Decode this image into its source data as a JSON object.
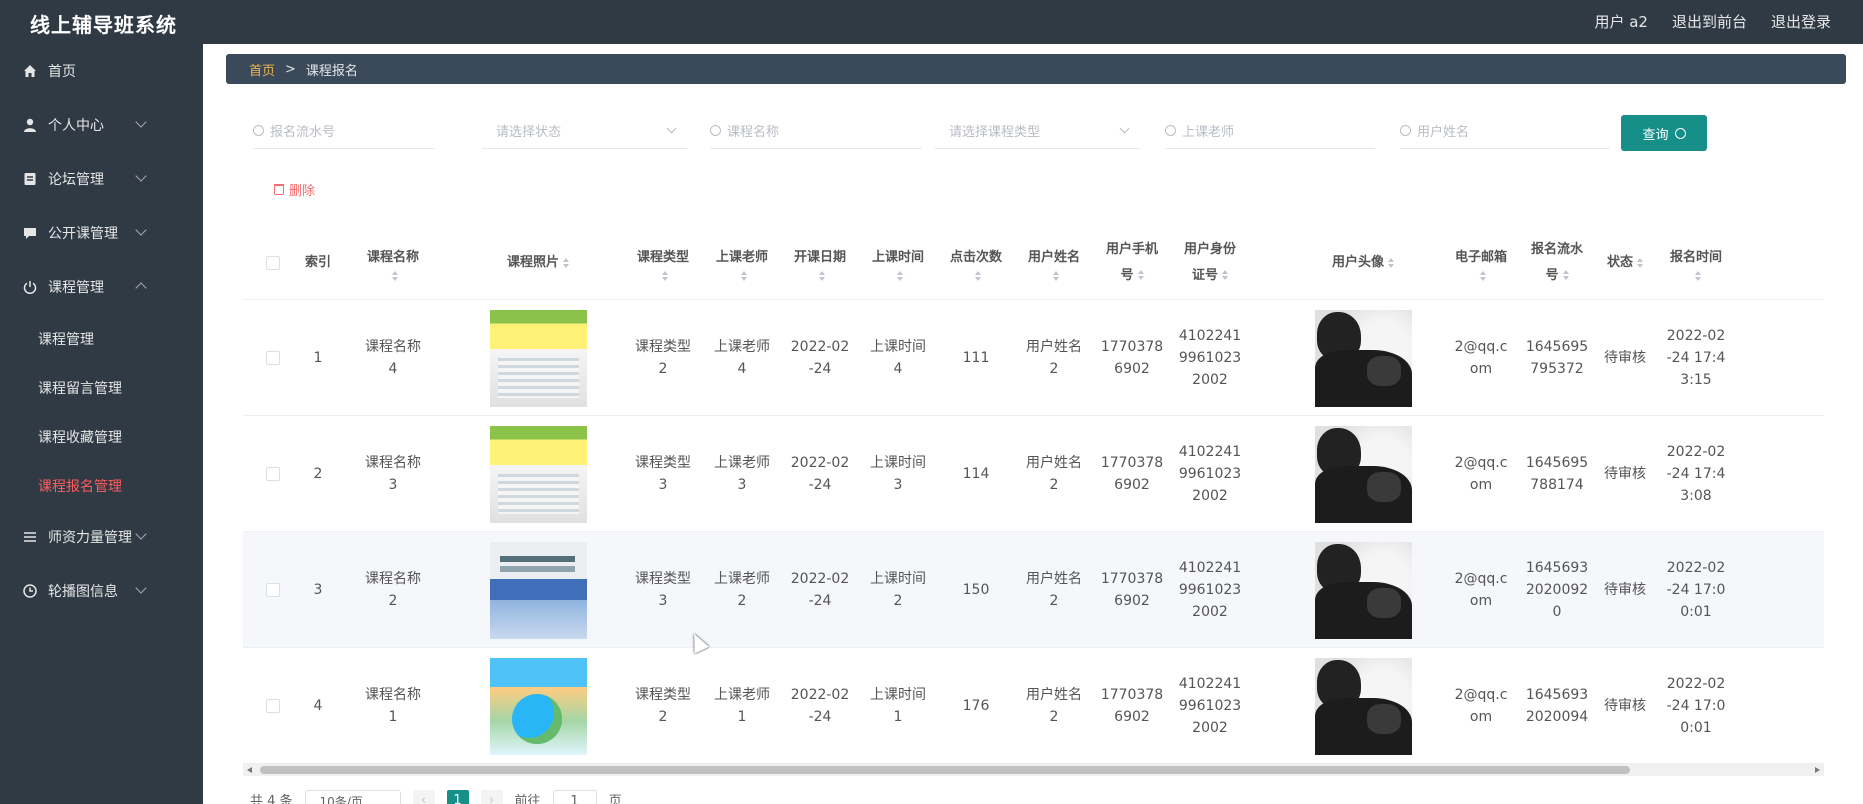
{
  "app": {
    "title": "线上辅导班系统",
    "top_links": [
      "用户 a2",
      "退出到前台",
      "退出登录"
    ]
  },
  "sidebar": {
    "items": [
      {
        "label": "首页",
        "icon": "home-icon",
        "expandable": false
      },
      {
        "label": "个人中心",
        "icon": "user-icon",
        "expandable": true
      },
      {
        "label": "论坛管理",
        "icon": "forum-icon",
        "expandable": true
      },
      {
        "label": "公开课管理",
        "icon": "chat-icon",
        "expandable": true
      },
      {
        "label": "课程管理",
        "icon": "power-icon",
        "expandable": true,
        "expanded": true,
        "children": [
          "课程管理",
          "课程留言管理",
          "课程收藏管理",
          "课程报名管理"
        ],
        "active_child": 3
      },
      {
        "label": "师资力量管理",
        "icon": "list-icon",
        "expandable": true
      },
      {
        "label": "轮播图信息",
        "icon": "clock-icon",
        "expandable": true
      }
    ]
  },
  "breadcrumb": {
    "home": "首页",
    "separator": ">",
    "current": "课程报名"
  },
  "search": {
    "fields": [
      {
        "placeholder": "报名流水号",
        "type": "input"
      },
      {
        "placeholder": "请选择状态",
        "type": "select"
      },
      {
        "placeholder": "课程名称",
        "type": "input"
      },
      {
        "placeholder": "请选择课程类型",
        "type": "select"
      },
      {
        "placeholder": "上课老师",
        "type": "input"
      },
      {
        "placeholder": "用户姓名",
        "type": "input"
      }
    ],
    "query_label": "查询"
  },
  "actions": {
    "delete_label": "删除"
  },
  "table": {
    "headers": {
      "index": "索引",
      "course_name": [
        "课程名称"
      ],
      "photo": "课程照片",
      "course_type": [
        "课程类型"
      ],
      "teacher": [
        "上课老师"
      ],
      "start_date": [
        "开课日期"
      ],
      "class_time": [
        "上课时间"
      ],
      "clicks": [
        "点击次数"
      ],
      "user_name": [
        "用户姓名"
      ],
      "phone": [
        "用户手机",
        "号"
      ],
      "id_card": [
        "用户身份",
        "证号"
      ],
      "avatar": "用户头像",
      "email": [
        "电子邮箱"
      ],
      "serial": [
        "报名流水",
        "号"
      ],
      "status": "状态",
      "time": [
        "报名时间"
      ]
    },
    "rows": [
      {
        "index": "1",
        "course_name": [
          "课程名称",
          "4"
        ],
        "photo": "green-book",
        "course_type": [
          "课程类型",
          "2"
        ],
        "teacher": [
          "上课老师",
          "4"
        ],
        "start_date": [
          "2022-02",
          "-24"
        ],
        "class_time": [
          "上课时间",
          "4"
        ],
        "clicks": "111",
        "user_name": [
          "用户姓名",
          "2"
        ],
        "phone": [
          "1770378",
          "6902"
        ],
        "id_card": [
          "4102241",
          "9961023",
          "2002"
        ],
        "email": [
          "2@qq.c",
          "om"
        ],
        "serial": [
          "1645695",
          "795372"
        ],
        "status": "待审核",
        "time": [
          "2022-02",
          "-24 17:4",
          "3:15"
        ]
      },
      {
        "index": "2",
        "course_name": [
          "课程名称",
          "3"
        ],
        "photo": "green-book",
        "course_type": [
          "课程类型",
          "3"
        ],
        "teacher": [
          "上课老师",
          "3"
        ],
        "start_date": [
          "2022-02",
          "-24"
        ],
        "class_time": [
          "上课时间",
          "3"
        ],
        "clicks": "114",
        "user_name": [
          "用户姓名",
          "2"
        ],
        "phone": [
          "1770378",
          "6902"
        ],
        "id_card": [
          "4102241",
          "9961023",
          "2002"
        ],
        "email": [
          "2@qq.c",
          "om"
        ],
        "serial": [
          "1645695",
          "788174"
        ],
        "status": "待审核",
        "time": [
          "2022-02",
          "-24 17:4",
          "3:08"
        ]
      },
      {
        "index": "3",
        "course_name": [
          "课程名称",
          "2"
        ],
        "photo": "blue-book",
        "course_type": [
          "课程类型",
          "3"
        ],
        "teacher": [
          "上课老师",
          "2"
        ],
        "start_date": [
          "2022-02",
          "-24"
        ],
        "class_time": [
          "上课时间",
          "2"
        ],
        "clicks": "150",
        "user_name": [
          "用户姓名",
          "2"
        ],
        "phone": [
          "1770378",
          "6902"
        ],
        "id_card": [
          "4102241",
          "9961023",
          "2002"
        ],
        "email": [
          "2@qq.c",
          "om"
        ],
        "serial": [
          "1645693",
          "2020092",
          "0"
        ],
        "status": "待审核",
        "time": [
          "2022-02",
          "-24 17:0",
          "0:01"
        ]
      },
      {
        "index": "4",
        "course_name": [
          "课程名称",
          "1"
        ],
        "photo": "math-book",
        "course_type": [
          "课程类型",
          "2"
        ],
        "teacher": [
          "上课老师",
          "1"
        ],
        "start_date": [
          "2022-02",
          "-24"
        ],
        "class_time": [
          "上课时间",
          "1"
        ],
        "clicks": "176",
        "user_name": [
          "用户姓名",
          "2"
        ],
        "phone": [
          "1770378",
          "6902"
        ],
        "id_card": [
          "4102241",
          "9961023",
          "2002"
        ],
        "email": [
          "2@qq.c",
          "om"
        ],
        "serial": [
          "1645693",
          "2020094"
        ],
        "status": "待审核",
        "time": [
          "2022-02",
          "-24 17:0",
          "0:01"
        ]
      }
    ]
  },
  "pagination": {
    "total": "共 4 条",
    "page_size": "10条/页",
    "current_page": "1",
    "goto_label": "前往",
    "goto_value": "1",
    "page_unit": "页"
  },
  "colors": {
    "sidebar_bg": "#2f3a45",
    "accent": "#158f88",
    "active_menu": "#ff5c5c",
    "delete": "#f56c6c",
    "crumb_home": "#f0b44c"
  }
}
